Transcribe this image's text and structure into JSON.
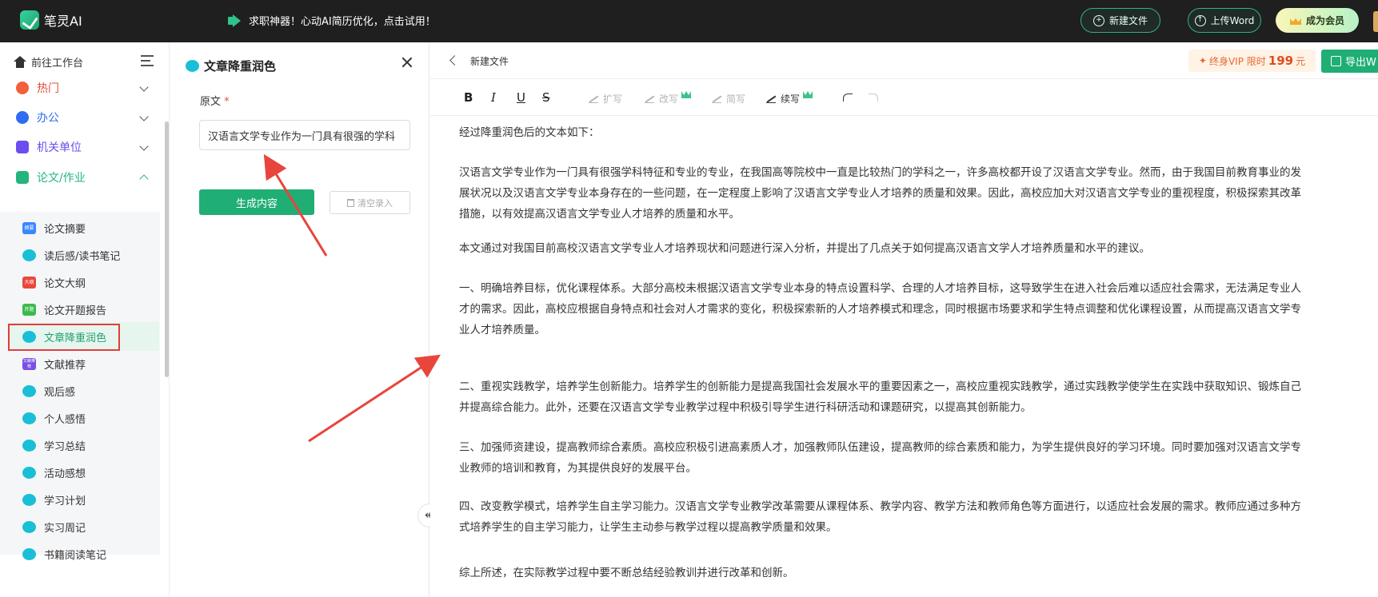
{
  "app": {
    "name": "笔灵AI",
    "promo": "求职神器！心动AI简历优化，点击试用！",
    "buttons": {
      "new_file": "新建文件",
      "upload_word": "上传Word",
      "become_member": "成为会员"
    }
  },
  "sidebar": {
    "back_to_workspace": "前往工作台",
    "categories": [
      {
        "label": "热门",
        "color": "#e0503a"
      },
      {
        "label": "办公",
        "color": "#2f6cf0"
      },
      {
        "label": "机关单位",
        "color": "#6b4df0"
      },
      {
        "label": "论文/作业",
        "color": "#24b47e"
      }
    ],
    "items": [
      {
        "label": "论文摘要",
        "badge": "摘要"
      },
      {
        "label": "读后感/读书笔记",
        "badge": ""
      },
      {
        "label": "论文大纲",
        "badge": "大纲"
      },
      {
        "label": "论文开题报告",
        "badge": "开题"
      },
      {
        "label": "文章降重润色",
        "badge": ""
      },
      {
        "label": "文献推荐",
        "badge": "文献推荐"
      },
      {
        "label": "观后感",
        "badge": ""
      },
      {
        "label": "个人感悟",
        "badge": ""
      },
      {
        "label": "学习总结",
        "badge": ""
      },
      {
        "label": "活动感想",
        "badge": ""
      },
      {
        "label": "学习计划",
        "badge": ""
      },
      {
        "label": "实习周记",
        "badge": ""
      },
      {
        "label": "书籍阅读笔记",
        "badge": ""
      }
    ]
  },
  "tool_panel": {
    "title": "文章降重润色",
    "field_label": "原文",
    "required_mark": "*",
    "field_value": "汉语言文学专业作为一门具有很强的学科",
    "generate_button": "生成内容",
    "clear_button": "清空录入"
  },
  "editor": {
    "doc_title": "新建文件",
    "vip_promo_prefix": "终身VIP 限时",
    "vip_price": "199",
    "vip_price_unit": "元",
    "export_button": "导出W",
    "toolbar": {
      "bold": "B",
      "italic": "I",
      "underline": "U",
      "strike": "S",
      "expand": "扩写",
      "rewrite": "改写",
      "shorten": "简写",
      "continue": "续写"
    },
    "paragraphs": [
      [
        "经过降重润色后的文本如下："
      ],
      [
        "汉语言文学专业作为一门具有很强学科特征和专业的专业，在我国高等院校中一直是比较热门的学科之一，许多高校都开设了汉语言文学专业。然而，由于我国目前教育事业的发",
        "展状况以及汉语言文学专业本身存在的一些问题，在一定程度上影响了汉语言文学专业人才培养的质量和效果。因此，高校应加大对汉语言文学专业的重视程度，积极探索其改革",
        "措施，以有效提高汉语言文学专业人才培养的质量和水平。"
      ],
      [
        "本文通过对我国目前高校汉语言文学专业人才培养现状和问题进行深入分析，并提出了几点关于如何提高汉语言文学人才培养质量和水平的建议。"
      ],
      [
        "一、明确培养目标，优化课程体系。大部分高校未根据汉语言文学专业本身的特点设置科学、合理的人才培养目标，这导致学生在进入社会后难以适应社会需求，无法满足专业人",
        "才的需求。因此，高校应根据自身特点和社会对人才需求的变化，积极探索新的人才培养模式和理念，同时根据市场要求和学生特点调整和优化课程设置，从而提高汉语言文学专",
        "业人才培养质量。"
      ],
      [
        "二、重视实践教学，培养学生创新能力。培养学生的创新能力是提高我国社会发展水平的重要因素之一，高校应重视实践教学，通过实践教学使学生在实践中获取知识、锻炼自己",
        "并提高综合能力。此外，还要在汉语言文学专业教学过程中积极引导学生进行科研活动和课题研究，以提高其创新能力。"
      ],
      [
        "三、加强师资建设，提高教师综合素质。高校应积极引进高素质人才，加强教师队伍建设，提高教师的综合素质和能力，为学生提供良好的学习环境。同时要加强对汉语言文学专",
        "业教师的培训和教育，为其提供良好的发展平台。"
      ],
      [
        "四、改变教学模式，培养学生自主学习能力。汉语言文学专业教学改革需要从课程体系、教学内容、教学方法和教师角色等方面进行，以适应社会发展的需求。教师应通过多种方",
        "式培养学生的自主学习能力，让学生主动参与教学过程以提高教学质量和效果。"
      ],
      [
        "综上所述，在实际教学过程中要不断总结经验教训并进行改革和创新。"
      ]
    ]
  },
  "colors": {
    "accent_green": "#1fae74",
    "annotation_red": "#e03d3d",
    "topbar": "#1f1f1f"
  }
}
